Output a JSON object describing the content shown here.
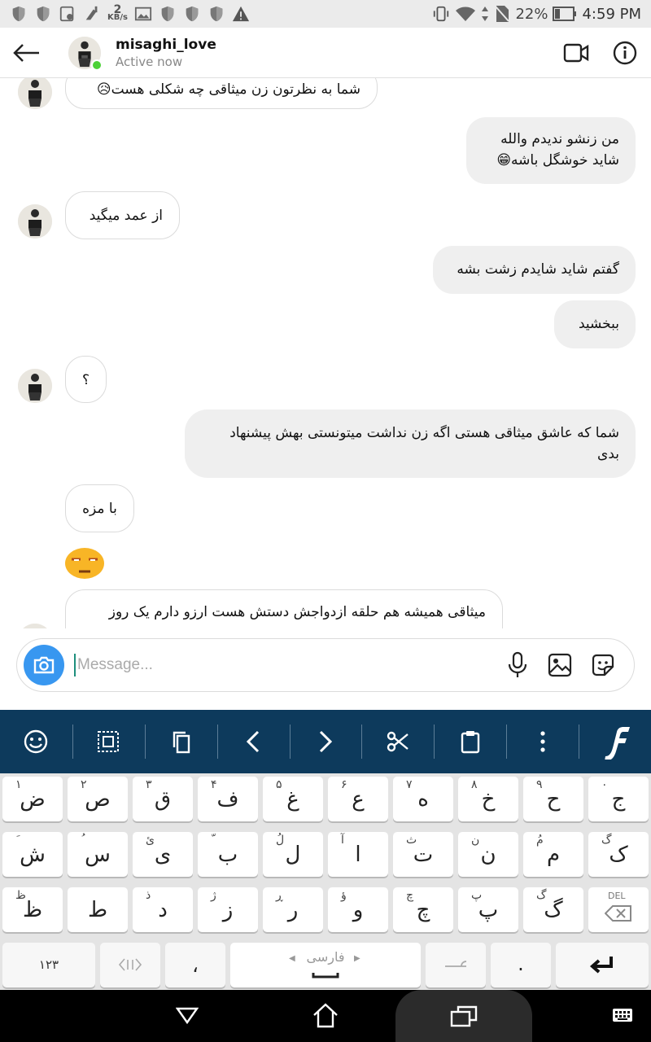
{
  "status_bar": {
    "speed_value": "2",
    "speed_unit": "KB/s",
    "battery": "22%",
    "time": "4:59 PM"
  },
  "header": {
    "username": "misaghi_love",
    "status": "Active now"
  },
  "messages": [
    {
      "side": "in",
      "text": "شما به نظرتون زن میثاقی چه شکلی هست😥"
    },
    {
      "side": "out",
      "lines": [
        "من زنشو ندیدم والله",
        "شاید خوشگل باشه😁"
      ]
    },
    {
      "side": "in",
      "text": "از عمد میگید"
    },
    {
      "side": "out",
      "text": "گفتم شاید شایدم زشت بشه"
    },
    {
      "side": "out",
      "text": "ببخشید"
    },
    {
      "side": "in",
      "text": "؟"
    },
    {
      "side": "out",
      "lines": [
        "شما که عاشق میثاقی هستی اگه زن نداشت میتونستی بهش پیشنهاد",
        "بدی"
      ]
    },
    {
      "side": "in",
      "text": "با مزه"
    },
    {
      "side": "in",
      "emoji": "unamused-face"
    },
    {
      "side": "in",
      "text": "میثاقی همیشه هم حلقه ازدواجش دستش هست ارزو دارم یک روز"
    }
  ],
  "composer": {
    "placeholder": "Message..."
  },
  "keyboard": {
    "row1": [
      {
        "main": "ض",
        "hint": "۱"
      },
      {
        "main": "ص",
        "hint": "۲"
      },
      {
        "main": "ق",
        "hint": "۳"
      },
      {
        "main": "ف",
        "hint": "۴"
      },
      {
        "main": "غ",
        "hint": "۵"
      },
      {
        "main": "ع",
        "hint": "۶"
      },
      {
        "main": "ه",
        "hint": "۷"
      },
      {
        "main": "خ",
        "hint": "۸"
      },
      {
        "main": "ح",
        "hint": "۹"
      },
      {
        "main": "ج",
        "hint": "۰"
      }
    ],
    "row2": [
      {
        "main": "ش",
        "hint": "َ"
      },
      {
        "main": "س",
        "hint": "ُ"
      },
      {
        "main": "ی",
        "hint": "ئ"
      },
      {
        "main": "ب",
        "hint": "ّ"
      },
      {
        "main": "ل",
        "hint": "لُ"
      },
      {
        "main": "ا",
        "hint": "آ"
      },
      {
        "main": "ت",
        "hint": "ث"
      },
      {
        "main": "ن",
        "hint": "ن"
      },
      {
        "main": "م",
        "hint": "مُ"
      },
      {
        "main": "ک",
        "hint": "گ"
      }
    ],
    "row3": [
      {
        "main": "ظ",
        "hint": "ظ"
      },
      {
        "main": "ط",
        "hint": ""
      },
      {
        "main": "د",
        "hint": "ذ"
      },
      {
        "main": "ز",
        "hint": "ژ"
      },
      {
        "main": "ر",
        "hint": "ڕ"
      },
      {
        "main": "و",
        "hint": "ؤ"
      },
      {
        "main": "چ",
        "hint": "چ"
      },
      {
        "main": "پ",
        "hint": "پ"
      },
      {
        "main": "گ",
        "hint": "گ"
      }
    ],
    "del_label": "DEL",
    "numbers_label": "۱۲۳",
    "comma": "،",
    "space_label": "فارسی",
    "period": "."
  }
}
